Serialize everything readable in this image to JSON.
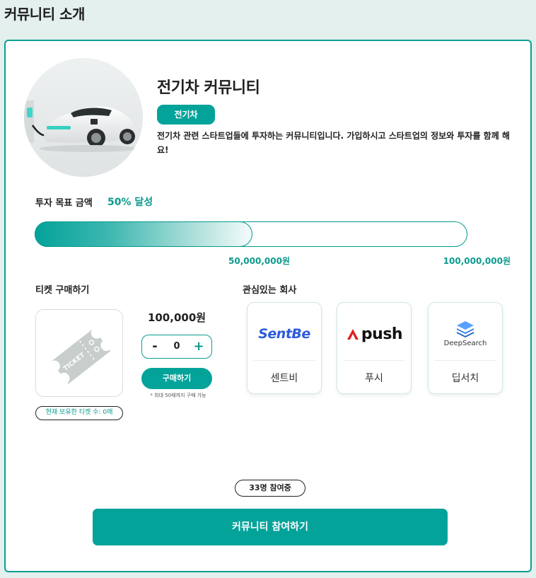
{
  "page": {
    "title": "커뮤니티 소개"
  },
  "community": {
    "name": "전기차 커뮤니티",
    "tag": "전기차",
    "description": "전기차 관련 스타트업들에 투자하는 커뮤니티입니다. 가입하시고 스타트업의 정보와 투자를 함께 해요!",
    "image": "electric-car-charging-photo"
  },
  "goal": {
    "label": "투자 목표 금액",
    "status": "50% 달성",
    "progress_fraction": 0.5,
    "current_amount": "50,000,000원",
    "target_amount": "100,000,000원"
  },
  "ticket": {
    "section_title": "티켓 구매하기",
    "image": "ticket-icon",
    "ticket_text": "TICKET",
    "price": "100,000원",
    "quantity": "0",
    "minus": "-",
    "plus": "+",
    "buy_label": "구매하기",
    "note": "* 최대 50매까지 구매 가능",
    "owned": "현재 보유한 티켓 수: 0매"
  },
  "interests": {
    "title": "관심있는 회사",
    "companies": [
      {
        "name": "센트비",
        "logo_text": "SentBe",
        "logo_color": "#2d5bdc"
      },
      {
        "name": "푸시",
        "logo_text": "push",
        "logo_color": "#e02020"
      },
      {
        "name": "딥서치",
        "logo_text": "DeepSearch",
        "logo_color": "#1f6fd8"
      }
    ]
  },
  "footer": {
    "members": "33명 참여중",
    "join_label": "커뮤니티 참여하기"
  },
  "colors": {
    "accent": "#03a39a",
    "accent_text": "#0d9a8e",
    "page_bg": "#e3f0ee"
  }
}
